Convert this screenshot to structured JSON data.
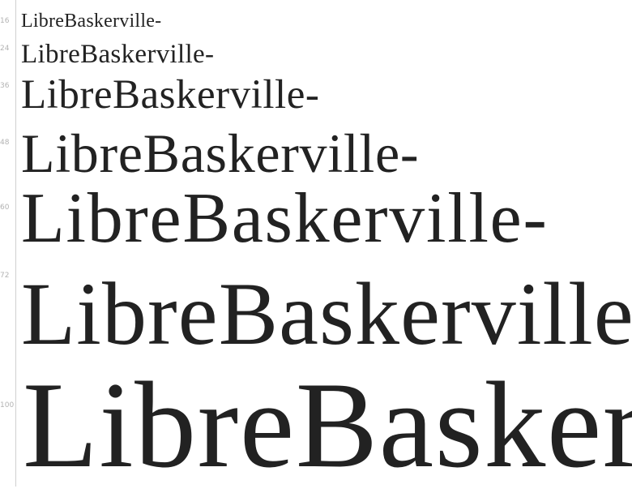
{
  "specimen": {
    "text": "LibreBaskerville-",
    "sizes": [
      {
        "label": "16"
      },
      {
        "label": "24"
      },
      {
        "label": "36"
      },
      {
        "label": "48"
      },
      {
        "label": "60"
      },
      {
        "label": "72"
      },
      {
        "label": "100"
      }
    ]
  },
  "colors": {
    "text": "#222222",
    "label": "#b3b3b3",
    "rule": "#d0d0d0",
    "background": "#ffffff"
  }
}
